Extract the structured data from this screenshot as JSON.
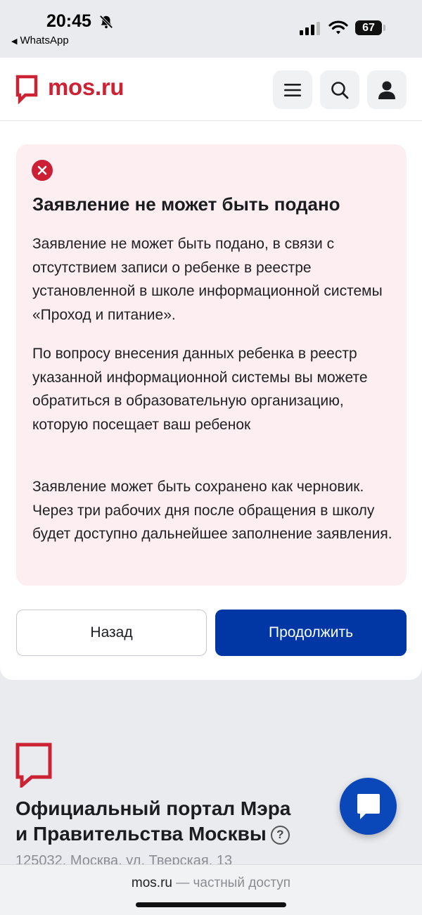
{
  "status_bar": {
    "time": "20:45",
    "back_app": "WhatsApp",
    "battery": "67"
  },
  "header": {
    "logo_text": "mos.ru",
    "menu_icon": "hamburger-icon",
    "search_icon": "search-icon",
    "profile_icon": "user-icon"
  },
  "error": {
    "title": "Заявление не может быть подано",
    "paragraphs": [
      "Заявление не может быть подано, в связи с отсутствием записи о ребенке в реестре установленной в школе информационной системы «Проход и питание».",
      "По вопросу внесения данных ребенка в реестр указанной информационной системы вы можете обратиться в образовательную организацию, которую посещает ваш ребенок",
      "Заявление может быть сохранено как черновик. Через три рабочих дня после обращения в школу будет доступно дальнейшее заполнение заявления."
    ]
  },
  "actions": {
    "back_label": "Назад",
    "continue_label": "Продолжить"
  },
  "footer": {
    "title_line1": "Официальный портал Мэра",
    "title_line2": "и Правительства Москвы",
    "help": "?",
    "address": "125032, Москва, ул. Тверская, 13"
  },
  "browser": {
    "domain": "mos.ru",
    "suffix": " — частный доступ"
  },
  "colors": {
    "brand_red": "#cc2233",
    "primary_blue": "#0037a5",
    "error_bg": "#fdeff1"
  }
}
